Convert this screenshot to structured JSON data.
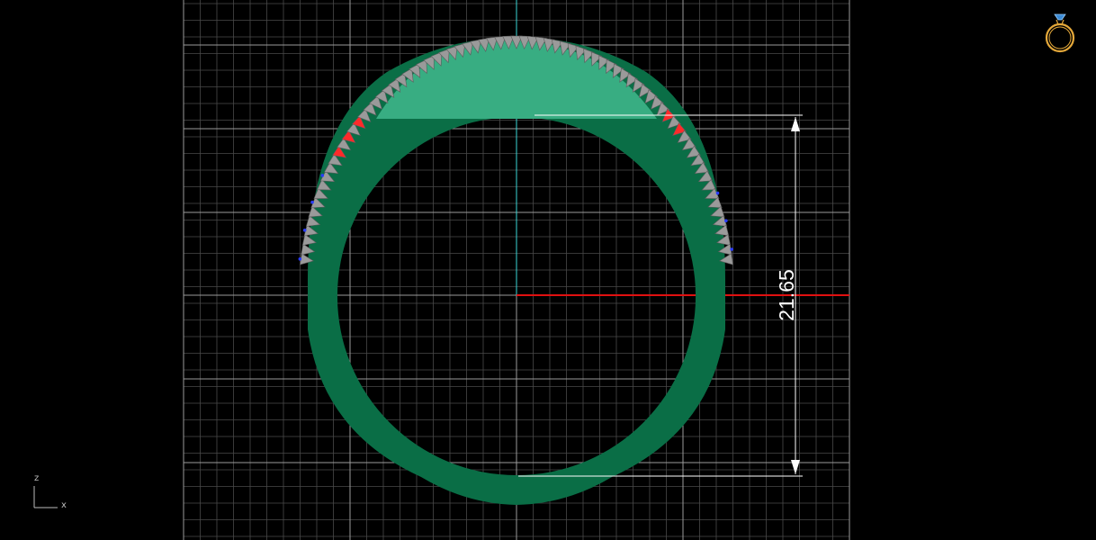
{
  "viewport": {
    "projection": "front",
    "dimension": {
      "value": "21.65"
    }
  },
  "axis_gizmo": {
    "vertical": "z",
    "horizontal": "x"
  },
  "colors": {
    "background": "#000000",
    "grid": "#8a8a8a",
    "axis_x": "#e01010",
    "axis_z": "#3ad6d6",
    "ring_body": "#0a6e46",
    "ring_top": "#38ad82",
    "stones": "#9a9a9a",
    "stone_accent_red": "#ff2a2a",
    "stone_accent_blue": "#2a3cff",
    "dimension": "#ffffff",
    "ring_icon": "#e4a83a"
  },
  "icons": {
    "view_cube": "ring-icon"
  }
}
